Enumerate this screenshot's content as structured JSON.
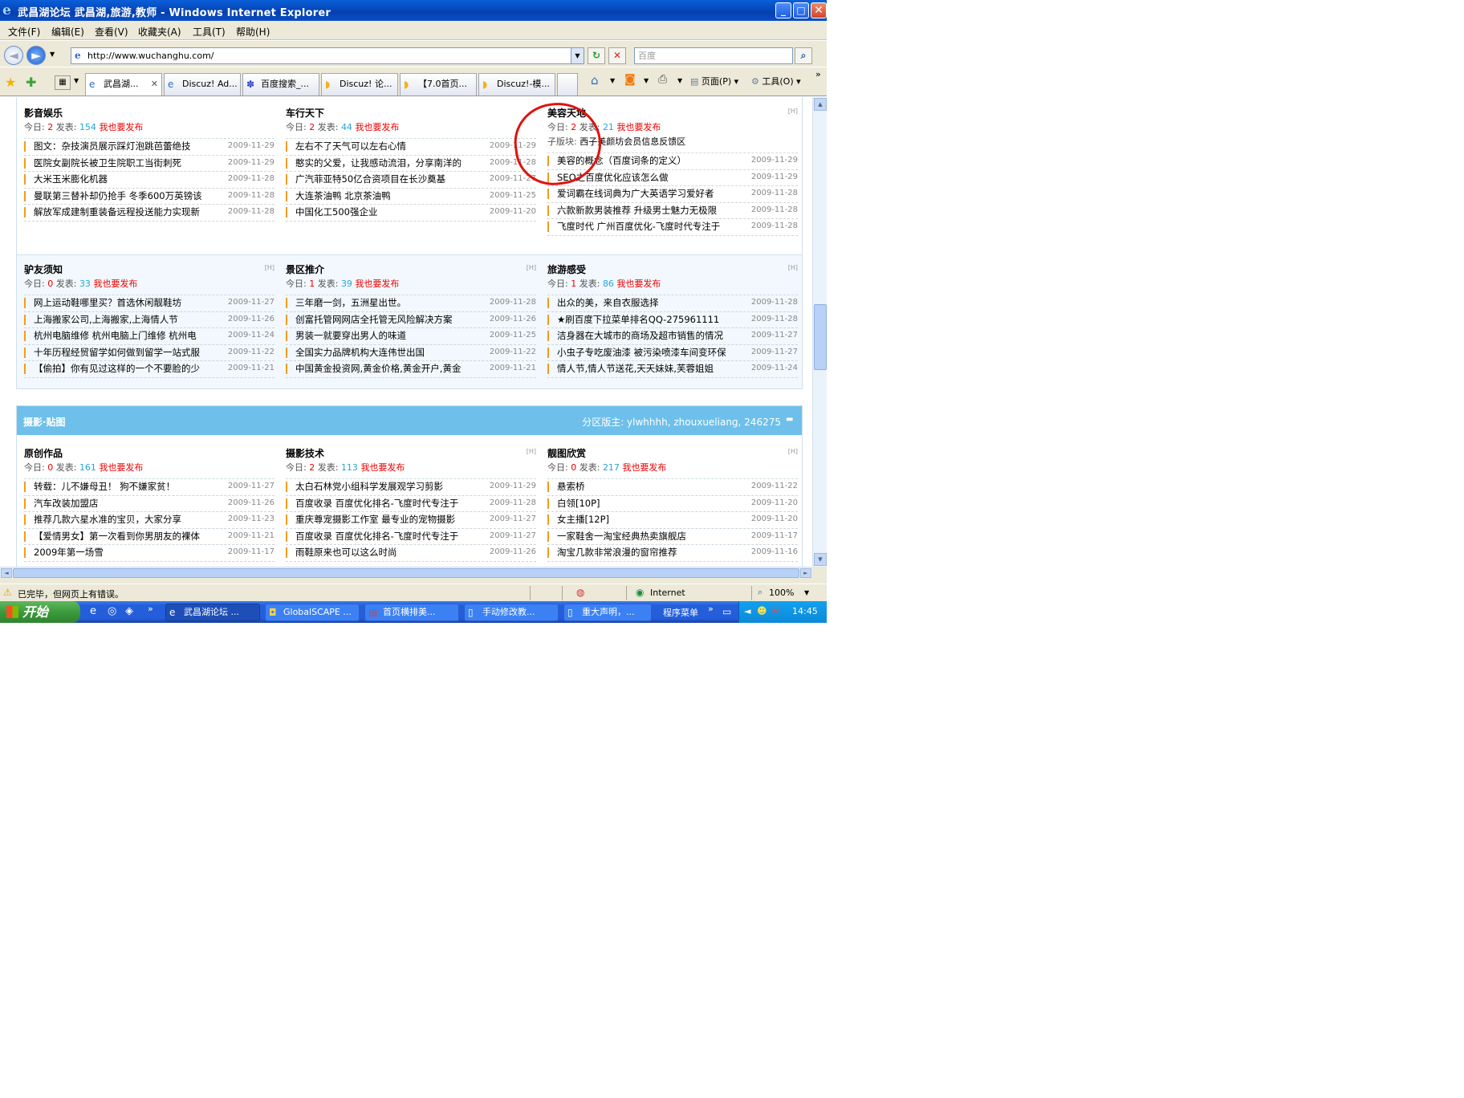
{
  "window": {
    "title": "武昌湖论坛 武昌湖,旅游,教师 - Windows Internet Explorer",
    "min": "_",
    "max": "□",
    "close": "✕"
  },
  "menu": [
    "文件(F)",
    "编辑(E)",
    "查看(V)",
    "收藏夹(A)",
    "工具(T)",
    "帮助(H)"
  ],
  "address": {
    "url": "http://www.wuchanghu.com/",
    "search_placeholder": "百度"
  },
  "nav": {
    "back": "◄",
    "forward": "►",
    "refresh": "↻",
    "stop": "✕",
    "go": "⌕"
  },
  "tabs": [
    {
      "label": "武昌湖...",
      "active": true,
      "icon": "e"
    },
    {
      "label": "Discuz! Ad...",
      "icon": "e"
    },
    {
      "label": "百度搜索_...",
      "icon": "b"
    },
    {
      "label": "Discuz! 论...",
      "icon": "d"
    },
    {
      "label": "【7.0首页...",
      "icon": "d"
    },
    {
      "label": "Discuz!-模...",
      "icon": "d"
    }
  ],
  "toolbar": {
    "page": "页面(P)",
    "tools": "工具(O)",
    "more": "»"
  },
  "stats_labels": {
    "today": "今日:",
    "posts": "发表:",
    "post_link": "我也要发布",
    "sub": "子版块:"
  },
  "section1": {
    "forums": [
      {
        "name": "影音娱乐",
        "today": "2",
        "posts": "154",
        "rss": "",
        "topics": [
          {
            "t": "图文：杂技演员展示踩灯泡跳芭蕾绝技",
            "d": "2009-11-29"
          },
          {
            "t": "医院女副院长被卫生院职工当街刺死",
            "d": "2009-11-29"
          },
          {
            "t": "大米玉米膨化机器",
            "d": "2009-11-28"
          },
          {
            "t": "曼联第三替补却仍抢手 冬季600万英镑该",
            "d": "2009-11-28"
          },
          {
            "t": "解放军成建制重装备远程投送能力实现新",
            "d": "2009-11-28"
          }
        ]
      },
      {
        "name": "车行天下",
        "today": "2",
        "posts": "44",
        "rss": "",
        "topics": [
          {
            "t": "左右不了天气可以左右心情",
            "d": "2009-11-29"
          },
          {
            "t": "憨实的父爱，让我感动流泪，分享南洋的",
            "d": "2009-11-28"
          },
          {
            "t": "广汽菲亚特50亿合资项目在长沙奠基",
            "d": "2009-11-27"
          },
          {
            "t": "大连茶油鸭 北京茶油鸭",
            "d": "2009-11-25"
          },
          {
            "t": "中国化工500强企业",
            "d": "2009-11-20"
          }
        ]
      },
      {
        "name": "美容天地",
        "today": "2",
        "posts": "21",
        "rss": "[H]",
        "sub": "西子美颜坊会员信息反馈区",
        "topics": [
          {
            "t": "美容的概念（百度词条的定义）",
            "d": "2009-11-29"
          },
          {
            "t": "SEO之百度优化应该怎么做",
            "d": "2009-11-29"
          },
          {
            "t": "爱词霸在线词典为广大英语学习爱好者",
            "d": "2009-11-28"
          },
          {
            "t": "六款新款男装推荐 升级男士魅力无极限",
            "d": "2009-11-28"
          },
          {
            "t": "飞度时代 广州百度优化-飞度时代专注于",
            "d": "2009-11-28"
          }
        ]
      }
    ]
  },
  "section2": {
    "forums": [
      {
        "name": "驴友须知",
        "today": "0",
        "posts": "33",
        "rss": "[H]",
        "topics": [
          {
            "t": "网上运动鞋哪里买？首选休闲靓鞋坊",
            "d": "2009-11-27"
          },
          {
            "t": "上海搬家公司,上海搬家,上海情人节",
            "d": "2009-11-26"
          },
          {
            "t": "杭州电脑维修 杭州电脑上门维修 杭州电",
            "d": "2009-11-24"
          },
          {
            "t": "十年历程经贸留学如何做到留学一站式服",
            "d": "2009-11-22"
          },
          {
            "t": "【偷拍】你有见过这样的一个不要脸的少",
            "d": "2009-11-21"
          }
        ]
      },
      {
        "name": "景区推介",
        "today": "1",
        "posts": "39",
        "rss": "[H]",
        "topics": [
          {
            "t": "三年磨一剑，五洲星出世。",
            "d": "2009-11-28"
          },
          {
            "t": "创富托管网网店全托管无风险解决方案",
            "d": "2009-11-26"
          },
          {
            "t": "男装一就要穿出男人的味道",
            "d": "2009-11-25"
          },
          {
            "t": "全国实力品牌机构大连伟世出国",
            "d": "2009-11-22"
          },
          {
            "t": "中国黄金投资网,黄金价格,黄金开户,黄金",
            "d": "2009-11-21"
          }
        ]
      },
      {
        "name": "旅游感受",
        "today": "1",
        "posts": "86",
        "rss": "[H]",
        "topics": [
          {
            "t": "出众的美，来自衣服选择",
            "d": "2009-11-28"
          },
          {
            "t": "★刷百度下拉菜单排名QQ-275961111",
            "d": "2009-11-28"
          },
          {
            "t": "洁身器在大城市的商场及超市销售的情况",
            "d": "2009-11-27"
          },
          {
            "t": "小虫子专吃废油漆 被污染喷漆车间变环保",
            "d": "2009-11-27"
          },
          {
            "t": "情人节,情人节送花,天天妹妹,芙蓉姐姐",
            "d": "2009-11-24"
          }
        ]
      }
    ]
  },
  "section3": {
    "name": "摄影·贴图",
    "moderators": "分区版主: ylwhhhh, zhouxueliang, 246275",
    "collapse": "▬",
    "forums": [
      {
        "name": "原创作品",
        "today": "0",
        "posts": "161",
        "rss": "",
        "topics": [
          {
            "t": "转载：儿不嫌母丑！ 狗不嫌家贫！",
            "d": "2009-11-27"
          },
          {
            "t": "汽车改装加盟店",
            "d": "2009-11-26"
          },
          {
            "t": "推荐几款六星水准的宝贝，大家分享",
            "d": "2009-11-23"
          },
          {
            "t": "【爱情男女】第一次看到你男朋友的裸体",
            "d": "2009-11-21"
          },
          {
            "t": "2009年第一场雪",
            "d": "2009-11-17"
          }
        ]
      },
      {
        "name": "摄影技术",
        "today": "2",
        "posts": "113",
        "rss": "[H]",
        "topics": [
          {
            "t": "太白石林党小组科学发展观学习剪影",
            "d": "2009-11-29"
          },
          {
            "t": "百度收录 百度优化排名-飞度时代专注于",
            "d": "2009-11-28"
          },
          {
            "t": "重庆尊宠摄影工作室 最专业的宠物摄影",
            "d": "2009-11-27"
          },
          {
            "t": "百度收录 百度优化排名-飞度时代专注于",
            "d": "2009-11-27"
          },
          {
            "t": "雨鞋原来也可以这么时尚",
            "d": "2009-11-26"
          }
        ]
      },
      {
        "name": "靓图欣赏",
        "today": "0",
        "posts": "217",
        "rss": "[H]",
        "topics": [
          {
            "t": "悬索桥",
            "d": "2009-11-22"
          },
          {
            "t": "白领[10P]",
            "d": "2009-11-20"
          },
          {
            "t": "女主播[12P]",
            "d": "2009-11-20"
          },
          {
            "t": "一家鞋舍一淘宝经典热卖旗舰店",
            "d": "2009-11-17"
          },
          {
            "t": "淘宝几款非常浪漫的窗帘推荐",
            "d": "2009-11-16"
          }
        ]
      }
    ]
  },
  "status": {
    "text": "已完毕，但网页上有错误。",
    "zone": "Internet",
    "zoom": "100%"
  },
  "taskbar": {
    "start": "开始",
    "tasks": [
      "武昌湖论坛 ...",
      "GlobalSCAPE ...",
      "首页横排美...",
      "手动修改教...",
      "重大声明，...",
      "程序菜单"
    ],
    "more": "»",
    "clock": "14:45"
  }
}
